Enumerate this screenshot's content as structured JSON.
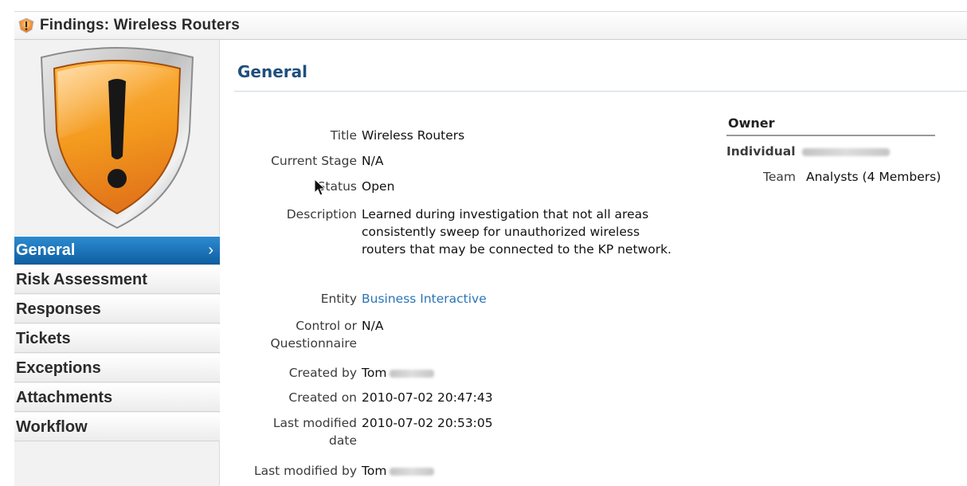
{
  "window": {
    "title": "Findings: Wireless Routers"
  },
  "sidebar": {
    "items": [
      {
        "label": "General",
        "active": true
      },
      {
        "label": "Risk Assessment"
      },
      {
        "label": "Responses"
      },
      {
        "label": "Tickets"
      },
      {
        "label": "Exceptions"
      },
      {
        "label": "Attachments"
      },
      {
        "label": "Workflow"
      }
    ]
  },
  "main": {
    "section_title": "General",
    "fields": {
      "title": {
        "label": "Title",
        "value": "Wireless Routers"
      },
      "current_stage": {
        "label": "Current Stage",
        "value": "N/A"
      },
      "status": {
        "label": "Status",
        "value": "Open"
      },
      "description": {
        "label": "Description",
        "value": "Learned during investigation that not all areas consistently sweep for unauthorized wireless routers that may be connected to the KP network."
      },
      "entity": {
        "label": "Entity",
        "value": "Business Interactive"
      },
      "control": {
        "label": "Control or Questionnaire",
        "value": "N/A"
      },
      "created_by": {
        "label": "Created by",
        "value": "Tom"
      },
      "created_on": {
        "label": "Created on",
        "value": "2010-07-02 20:47:43"
      },
      "last_modified_date": {
        "label": "Last modified date",
        "value": "2010-07-02 20:53:05"
      },
      "last_modified_by": {
        "label": "Last modified by",
        "value": "Tom"
      }
    }
  },
  "owner": {
    "title": "Owner",
    "individual_label": "Individual",
    "team_label": "Team",
    "team_value": "Analysts (4 Members)"
  },
  "colors": {
    "accent": "#1a6fb5",
    "link": "#2a76b6",
    "section_title": "#1f4f7e",
    "shield_orange": "#f39a1e"
  },
  "icons": {
    "window": "warning-icon",
    "hero": "warning-shield-icon",
    "nav_active": "chevron-right-icon"
  }
}
